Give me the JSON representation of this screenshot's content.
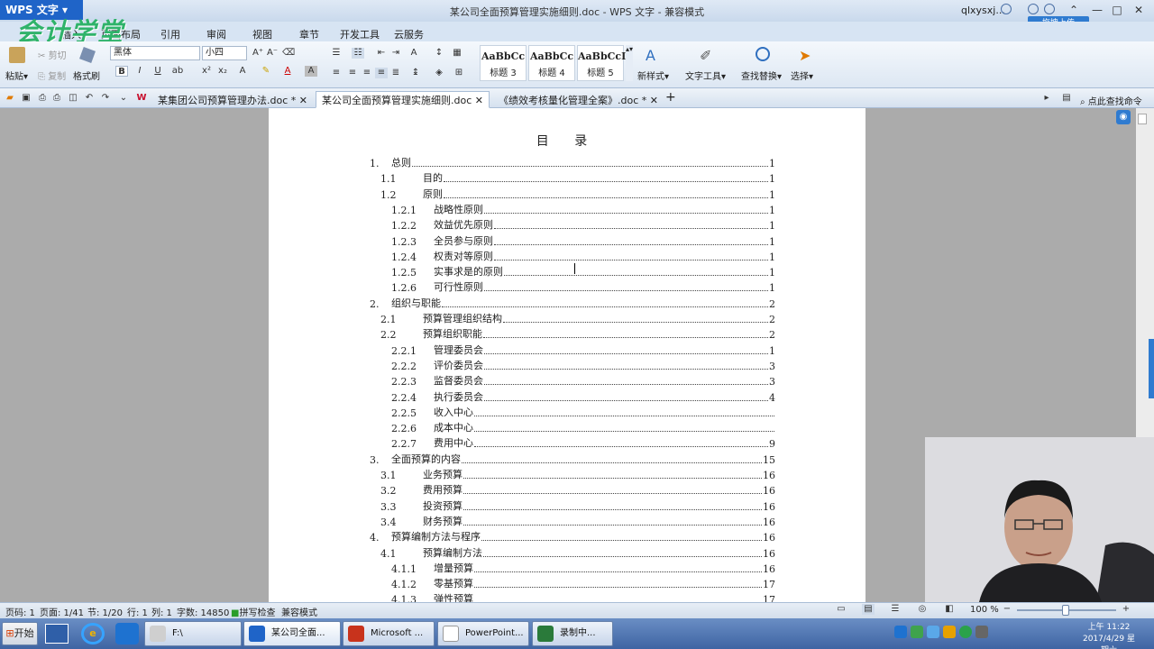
{
  "titlebar": {
    "app_name": "WPS 文字",
    "brand": "会计学堂",
    "doc_title": "某公司全面预算管理实施细则.doc - WPS 文字 - 兼容模式",
    "user": "qlxysxj...",
    "upload_label": "拖拽上传"
  },
  "menu": [
    "插入",
    "页面布局",
    "引用",
    "审阅",
    "视图",
    "章节",
    "开发工具",
    "云服务"
  ],
  "ribbon": {
    "paste_label": "粘贴",
    "cut_label": "剪切",
    "copy_label": "复制",
    "format_painter_label": "格式刷",
    "font_name": "黑体",
    "font_size": "小四",
    "styles": [
      {
        "sample": "AaBbCc",
        "name": "标题 3"
      },
      {
        "sample": "AaBbCc",
        "name": "标题 4"
      },
      {
        "sample": "AaBbCcI",
        "name": "标题 5"
      }
    ],
    "new_style_label": "新样式",
    "text_tools_label": "文字工具",
    "find_replace_label": "查找替换",
    "select_label": "选择",
    "find_cmd_label": "点此查找命令"
  },
  "tabs": [
    {
      "label": "某集团公司预算管理办法.doc *",
      "active": false
    },
    {
      "label": "某公司全面预算管理实施细则.doc",
      "active": true
    },
    {
      "label": "《绩效考核量化管理全案》.doc *",
      "active": false
    }
  ],
  "document": {
    "toc_title": "目 录",
    "entries": [
      {
        "num": "1.",
        "label": "总则",
        "page": "1",
        "level": 1
      },
      {
        "num": "1.1",
        "label": "目的",
        "page": "1",
        "level": 2
      },
      {
        "num": "1.2",
        "label": "原则",
        "page": "1",
        "level": 2
      },
      {
        "num": "1.2.1",
        "label": "战略性原则",
        "page": "1",
        "level": 3
      },
      {
        "num": "1.2.2",
        "label": "效益优先原则",
        "page": "1",
        "level": 3
      },
      {
        "num": "1.2.3",
        "label": "全员参与原则",
        "page": "1",
        "level": 3
      },
      {
        "num": "1.2.4",
        "label": "权责对等原则",
        "page": "1",
        "level": 3
      },
      {
        "num": "1.2.5",
        "label": "实事求是的原则",
        "page": "1",
        "level": 3
      },
      {
        "num": "1.2.6",
        "label": "可行性原则",
        "page": "1",
        "level": 3
      },
      {
        "num": "2.",
        "label": "组织与职能",
        "page": "2",
        "level": 1
      },
      {
        "num": "2.1",
        "label": "预算管理组织结构",
        "page": "2",
        "level": 2
      },
      {
        "num": "2.2",
        "label": "预算组织职能",
        "page": "2",
        "level": 2
      },
      {
        "num": "2.2.1",
        "label": "管理委员会",
        "page": "1",
        "level": 3
      },
      {
        "num": "2.2.2",
        "label": "评价委员会",
        "page": "3",
        "level": 3
      },
      {
        "num": "2.2.3",
        "label": "监督委员会",
        "page": "3",
        "level": 3
      },
      {
        "num": "2.2.4",
        "label": "执行委员会",
        "page": "4",
        "level": 3
      },
      {
        "num": "2.2.5",
        "label": "收入中心",
        "page": "",
        "level": 3
      },
      {
        "num": "2.2.6",
        "label": "成本中心",
        "page": "",
        "level": 3
      },
      {
        "num": "2.2.7",
        "label": "费用中心",
        "page": "9",
        "level": 3
      },
      {
        "num": "3.",
        "label": "全面预算的内容",
        "page": "15",
        "level": 1
      },
      {
        "num": "3.1",
        "label": "业务预算",
        "page": "16",
        "level": 2
      },
      {
        "num": "3.2",
        "label": "费用预算",
        "page": "16",
        "level": 2
      },
      {
        "num": "3.3",
        "label": "投资预算",
        "page": "16",
        "level": 2
      },
      {
        "num": "3.4",
        "label": "财务预算",
        "page": "16",
        "level": 2
      },
      {
        "num": "4.",
        "label": "预算编制方法与程序",
        "page": "16",
        "level": 1
      },
      {
        "num": "4.1",
        "label": "预算编制方法",
        "page": "16",
        "level": 2
      },
      {
        "num": "4.1.1",
        "label": "增量预算",
        "page": "16",
        "level": 3
      },
      {
        "num": "4.1.2",
        "label": "零基预算",
        "page": "17",
        "level": 3
      },
      {
        "num": "4.1.3",
        "label": "弹性预算",
        "page": "17",
        "level": 3
      }
    ]
  },
  "status": {
    "page_no": "页码: 1",
    "pages": "页面: 1/41",
    "section": "节: 1/20",
    "row": "行: 1",
    "col": "列: 1",
    "words": "字数: 14850",
    "spell": "拼写检查",
    "compat": "兼容模式",
    "zoom": "100 %"
  },
  "taskbar": {
    "start_label": "开始",
    "items": [
      "F:\\",
      "某公司全面...",
      "Microsoft ...",
      "PowerPoint...",
      "录制中..."
    ],
    "time": "上午 11:22",
    "date": "2017/4/29 星期六"
  }
}
